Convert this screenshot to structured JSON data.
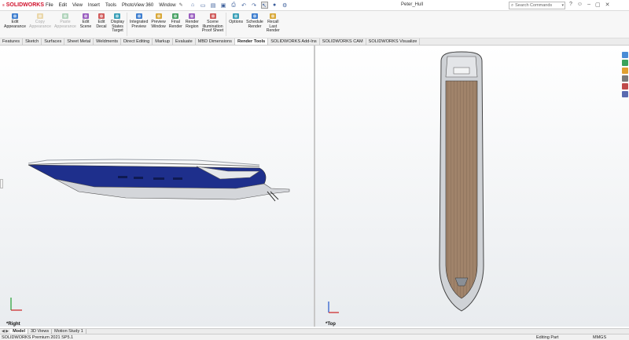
{
  "app": {
    "name": "SOLIDWORKS",
    "document_title": "Peter_Hull"
  },
  "menu": [
    "File",
    "Edit",
    "View",
    "Insert",
    "Tools",
    "PhotoView 360",
    "Window"
  ],
  "search": {
    "placeholder": "Search Commands"
  },
  "ribbon": [
    {
      "label": "Edit\nAppearance",
      "icon": "edit-appearance-icon",
      "enabled": true
    },
    {
      "label": "Copy\nAppearance",
      "icon": "copy-appearance-icon",
      "enabled": false
    },
    {
      "label": "Paste\nAppearance",
      "icon": "paste-appearance-icon",
      "enabled": false
    },
    {
      "label": "Edit\nScene",
      "icon": "edit-scene-icon",
      "enabled": true
    },
    {
      "label": "Edit\nDecal",
      "icon": "edit-decal-icon",
      "enabled": true
    },
    {
      "label": "Display\nStates\nTarget",
      "icon": "display-states-icon",
      "enabled": true
    },
    {
      "label": "Integrated\nPreview",
      "icon": "integrated-preview-icon",
      "enabled": true
    },
    {
      "label": "Preview\nWindow",
      "icon": "preview-window-icon",
      "enabled": true
    },
    {
      "label": "Final\nRender",
      "icon": "final-render-icon",
      "enabled": true
    },
    {
      "label": "Render\nRegion",
      "icon": "render-region-icon",
      "enabled": true
    },
    {
      "label": "Scene\nIllumination\nProof Sheet",
      "icon": "scene-illumination-icon",
      "enabled": true
    },
    {
      "label": "Options",
      "icon": "options-icon",
      "enabled": true
    },
    {
      "label": "Schedule\nRender",
      "icon": "schedule-render-icon",
      "enabled": true
    },
    {
      "label": "Recall\nLast\nRender",
      "icon": "recall-render-icon",
      "enabled": true
    }
  ],
  "command_tabs": [
    "Features",
    "Sketch",
    "Surfaces",
    "Sheet Metal",
    "Weldments",
    "Direct Editing",
    "Markup",
    "Evaluate",
    "MBD Dimensions",
    "Render Tools",
    "SOLIDWORKS Add-Ins",
    "SOLIDWORKS CAM",
    "SOLIDWORKS Visualize"
  ],
  "active_tab": "Render Tools",
  "viewports": {
    "left_label": "*Right",
    "right_label": "*Top"
  },
  "bottom_tabs": [
    "Model",
    "3D Views",
    "Motion Study 1"
  ],
  "status": {
    "product": "SOLIDWORKS Premium 2021 SP5.1",
    "mode": "Editing Part",
    "units": "MMGS"
  },
  "colors": {
    "hull_blue": "#1e2f8c",
    "deck_wood": "#a0836a",
    "brand_red": "#d0102b"
  }
}
